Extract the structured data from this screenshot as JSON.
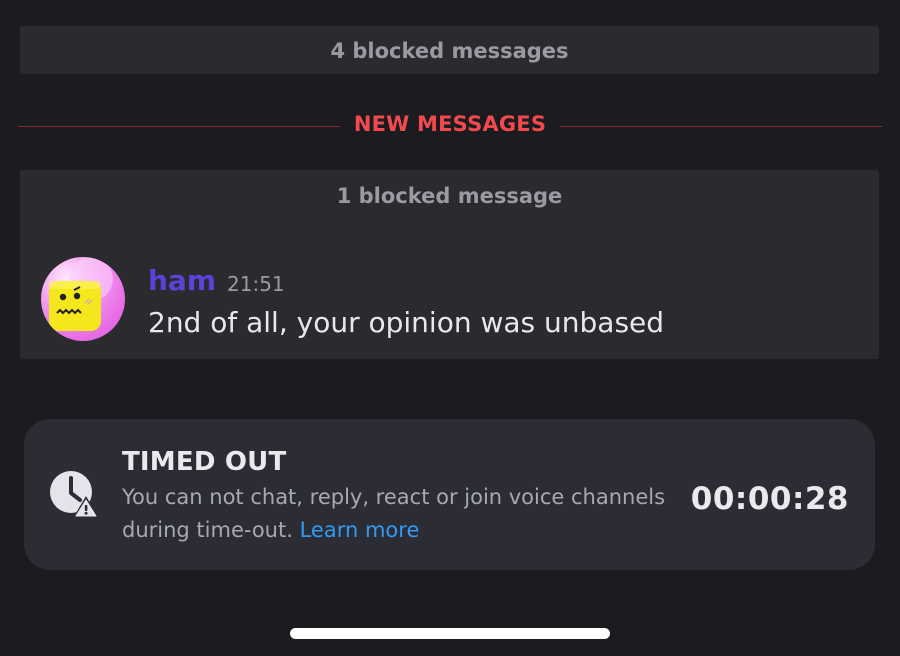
{
  "blocked_top": {
    "label": "4 blocked messages"
  },
  "divider": {
    "label": "NEW MESSAGES"
  },
  "blocked_group": {
    "label": "1 blocked message",
    "message": {
      "username": "ham",
      "timestamp": "21:51",
      "text": "2nd of all, your opinion was unbased",
      "avatar_icon": "avatar-yellow-face-icon"
    }
  },
  "timeout": {
    "title": "TIMED OUT",
    "description": "You can not chat, reply, react or join voice channels during time-out.",
    "learn_more": "Learn more",
    "countdown": "00:00:28",
    "icon": "clock-warning-icon"
  },
  "colors": {
    "background": "#1b1b20",
    "new_messages": "#f04a4f",
    "username": "#5a43d8",
    "link": "#2f9bf2",
    "card": "#2b2c34"
  }
}
